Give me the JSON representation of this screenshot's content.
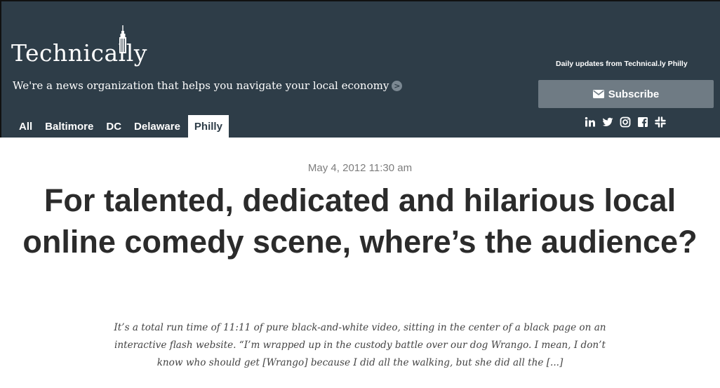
{
  "header": {
    "logo_text": "Technically",
    "tagline": "We're a news organization that helps you navigate your local economy",
    "tagline_arrow": ">",
    "daily_label": "Daily updates from Technical.ly Philly",
    "subscribe_label": "Subscribe",
    "nav": [
      {
        "label": "All",
        "active": false
      },
      {
        "label": "Baltimore",
        "active": false
      },
      {
        "label": "DC",
        "active": false
      },
      {
        "label": "Delaware",
        "active": false
      },
      {
        "label": "Philly",
        "active": true
      }
    ],
    "social_icons": [
      "linkedin-icon",
      "twitter-icon",
      "instagram-icon",
      "facebook-icon",
      "slack-icon"
    ]
  },
  "article": {
    "date": "May 4, 2012 11:30 am",
    "title": "For talented, dedicated and hilarious local online comedy scene, where’s the audience?",
    "excerpt": "It’s a total run time of 11:11 of pure black-and-white video, sitting in the center of a black page on an interactive flash website. “I’m wrapped up in the custody battle over our dog Wrango. I mean, I don’t know who should get [Wrango] because I did all the walking, but she did all the [...]"
  },
  "colors": {
    "header_bg": "#2e3d48",
    "subscribe_bg": "#6f7b84",
    "title": "#2b2b2b",
    "date": "#7d7d7d"
  }
}
